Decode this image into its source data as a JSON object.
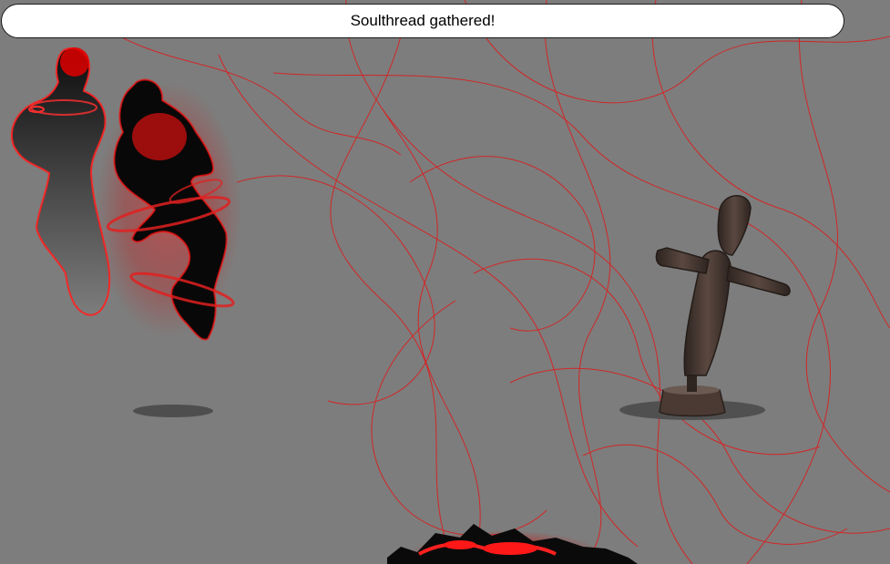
{
  "notification": {
    "text": "Soulthread gathered!"
  },
  "scene": {
    "player_character": "soulweaver-avatar",
    "target": "training-dummy",
    "effect": "soulthread-red-threads",
    "colors": {
      "background": "#7d7d7d",
      "thread": "#e01818",
      "glow": "#ff1a1a",
      "dummy_wood": "#4a3a33"
    }
  }
}
